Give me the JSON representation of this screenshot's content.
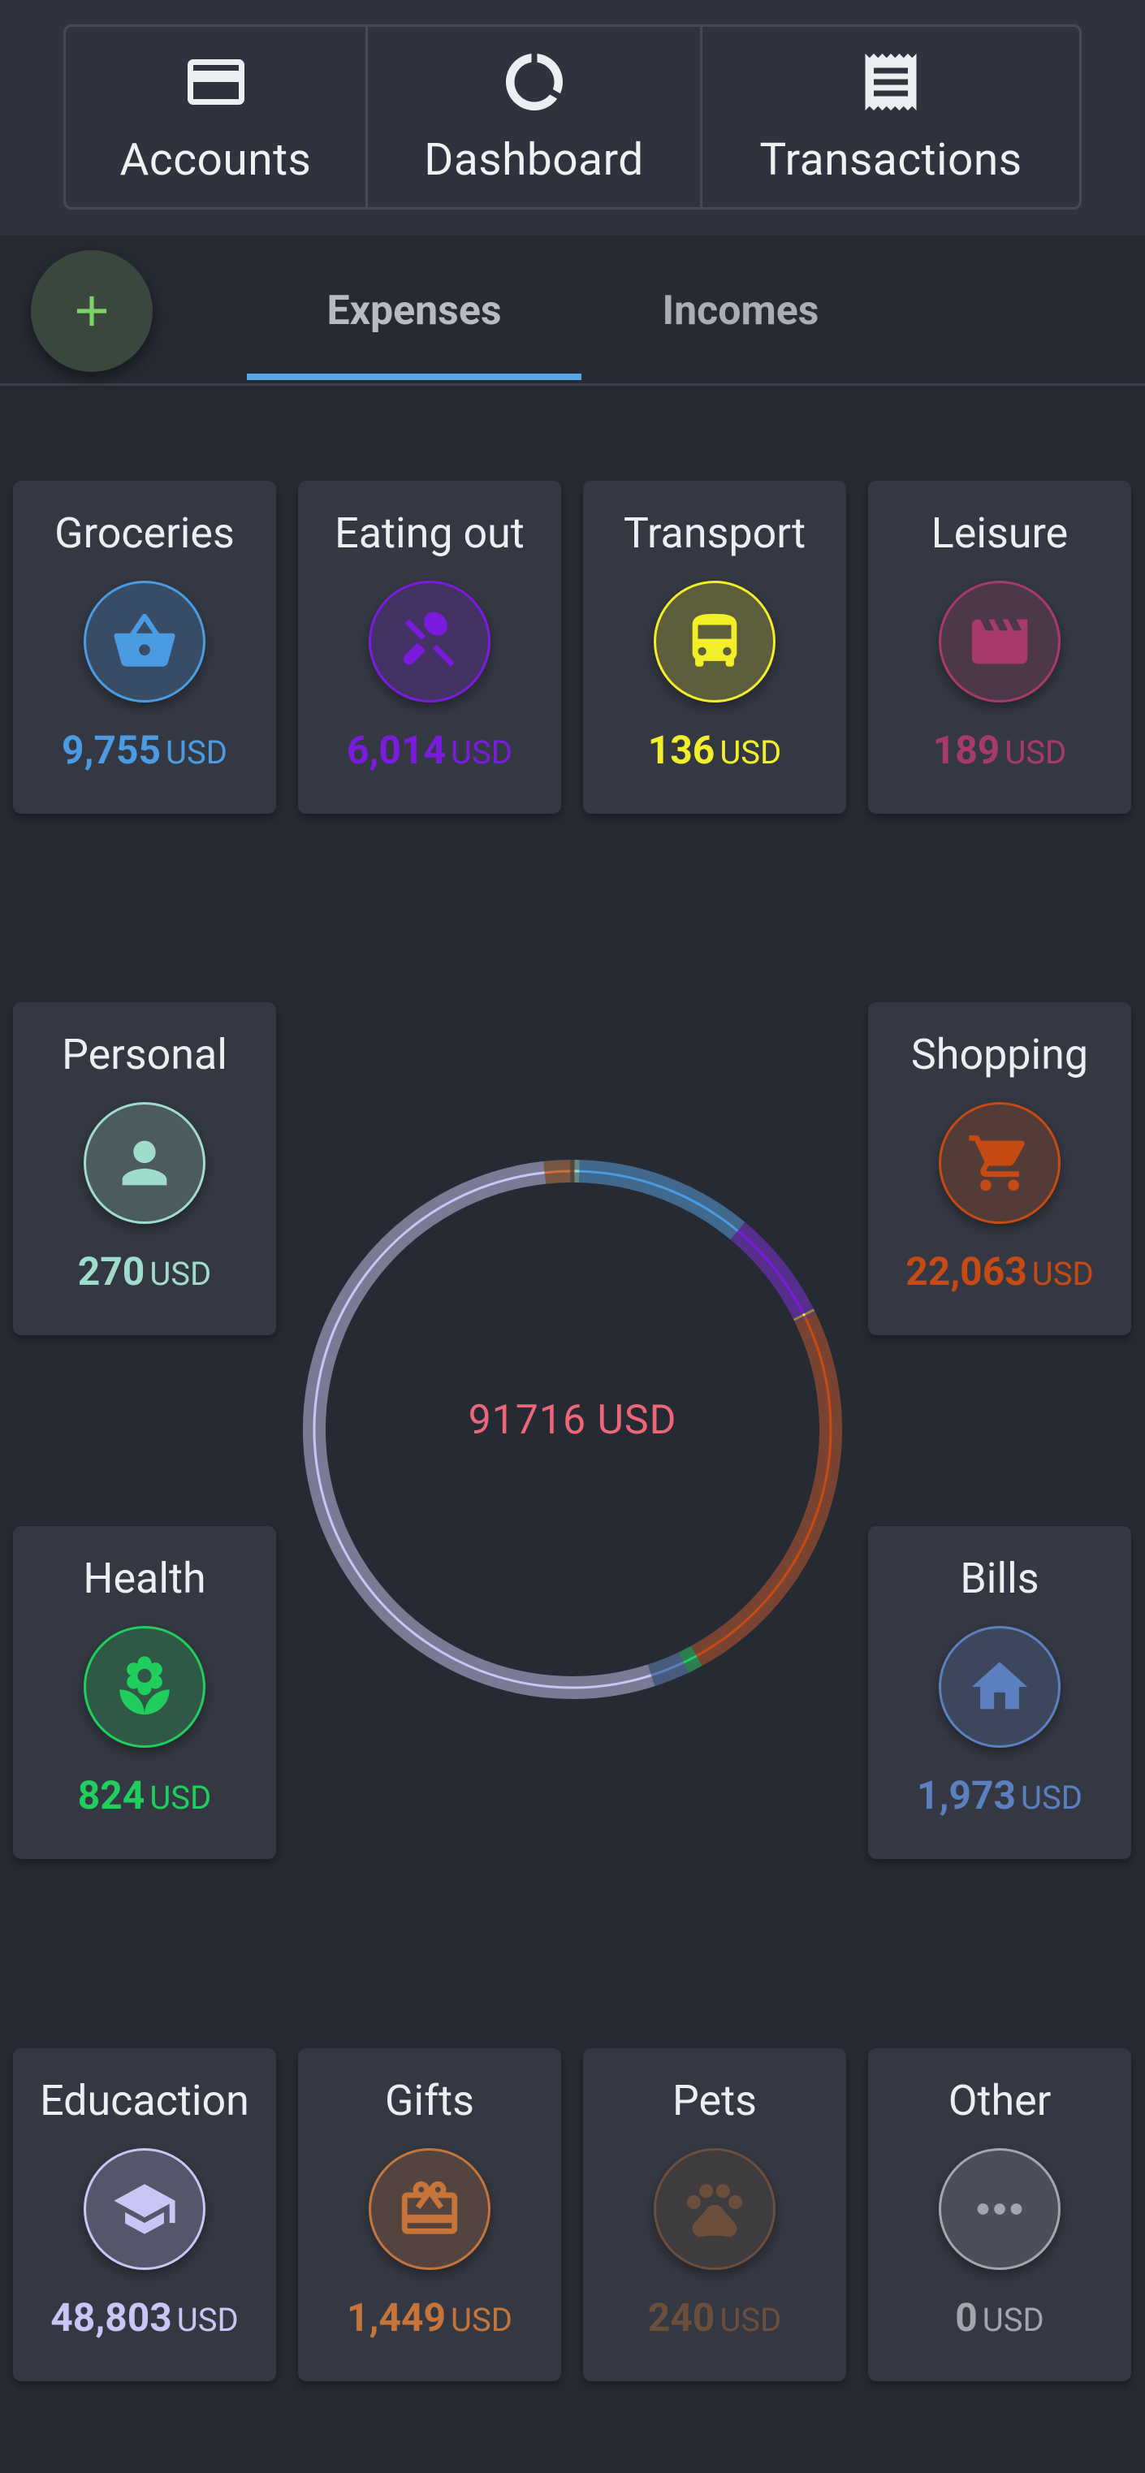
{
  "nav": {
    "accounts": "Accounts",
    "dashboard": "Dashboard",
    "transactions": "Transactions"
  },
  "tabs": {
    "expenses": "Expenses",
    "incomes": "Incomes",
    "active": "Expenses"
  },
  "icons": {
    "add": "plus-icon",
    "accounts": "credit-card-icon",
    "dashboard": "donut-chart-icon",
    "transactions": "receipt-icon"
  },
  "total": "91716 USD",
  "currency": "USD",
  "categories": {
    "groceries": {
      "name": "Groceries",
      "amount": "9,755",
      "value": 9755,
      "color": "#4b9be3",
      "icon": "basket-icon"
    },
    "eating_out": {
      "name": "Eating out",
      "amount": "6,014",
      "value": 6014,
      "color": "#7b1be0",
      "icon": "cutlery-icon"
    },
    "transport": {
      "name": "Transport",
      "amount": "136",
      "value": 136,
      "color": "#f3ee2a",
      "icon": "bus-icon"
    },
    "leisure": {
      "name": "Leisure",
      "amount": "189",
      "value": 189,
      "color": "#a83a6b",
      "icon": "clapperboard-icon"
    },
    "personal": {
      "name": "Personal",
      "amount": "270",
      "value": 270,
      "color": "#9fdccb",
      "icon": "person-icon"
    },
    "shopping": {
      "name": "Shopping",
      "amount": "22,063",
      "value": 22063,
      "color": "#c64a14",
      "icon": "cart-icon"
    },
    "health": {
      "name": "Health",
      "amount": "824",
      "value": 824,
      "color": "#1fce5c",
      "icon": "leaf-icon"
    },
    "bills": {
      "name": "Bills",
      "amount": "1,973",
      "value": 1973,
      "color": "#5b7fbf",
      "icon": "house-icon"
    },
    "education": {
      "name": "Educaction",
      "amount": "48,803",
      "value": 48803,
      "color": "#c7c6f5",
      "icon": "graduation-cap-icon"
    },
    "gifts": {
      "name": "Gifts",
      "amount": "1,449",
      "value": 1449,
      "color": "#c6743a",
      "icon": "gift-icon"
    },
    "pets": {
      "name": "Pets",
      "amount": "240",
      "value": 240,
      "color": "#6b4f3c",
      "icon": "paw-icon"
    },
    "other": {
      "name": "Other",
      "amount": "0",
      "value": 0,
      "color": "#a3a6ad",
      "icon": "more-dots-icon"
    }
  },
  "donut_order": [
    "groceries",
    "eating_out",
    "transport",
    "leisure",
    "shopping",
    "health",
    "bills",
    "education",
    "gifts",
    "pets",
    "personal"
  ]
}
